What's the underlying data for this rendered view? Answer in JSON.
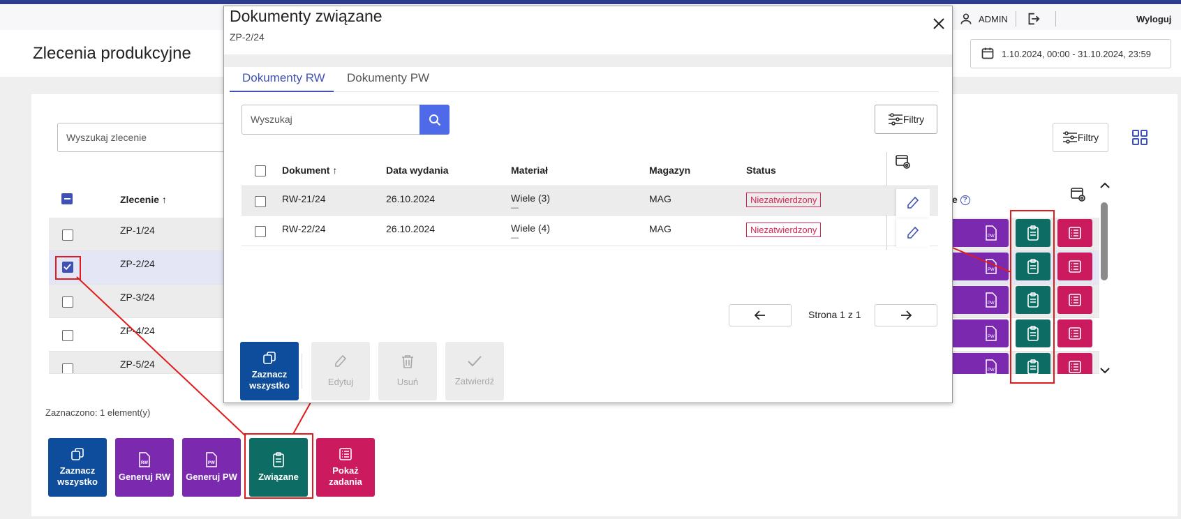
{
  "topbar": {
    "user": "ADMIN",
    "logout": "Wyloguj",
    "icons": [
      "refresh-icon",
      "help-icon",
      "user-icon",
      "logout-icon"
    ]
  },
  "page": {
    "title": "Zlecenia produkcyjne",
    "date_range": "1.10.2024, 00:00 - 31.10.2024, 23:59"
  },
  "main": {
    "search_placeholder": "Wyszukaj zlecenie",
    "filters_label": "Filtry",
    "column_header": "Zlecenie",
    "column_hint": "e",
    "rows": [
      "ZP-1/24",
      "ZP-2/24",
      "ZP-3/24",
      "ZP-4/24",
      "ZP-5/24"
    ],
    "selected_row_index": 1,
    "selected_count": "Zaznaczono: 1 element(y)",
    "action_icons": [
      "generate-pw-icon",
      "related-docs-icon",
      "tasks-icon"
    ]
  },
  "bulk_actions": [
    {
      "label": "Zaznacz wszystko",
      "color": "#0d4d9c"
    },
    {
      "label": "Generuj RW",
      "color": "#7b2ab0"
    },
    {
      "label": "Generuj PW",
      "color": "#7b2ab0"
    },
    {
      "label": "Związane",
      "color": "#0d6d64"
    },
    {
      "label": "Pokaż zadania",
      "color": "#cc1a5e"
    }
  ],
  "modal": {
    "title": "Dokumenty związane",
    "subtitle": "ZP-2/24",
    "tabs": [
      {
        "label": "Dokumenty RW",
        "active": true
      },
      {
        "label": "Dokumenty PW",
        "active": false
      }
    ],
    "search_placeholder": "Wyszukaj",
    "filters_label": "Filtry",
    "columns": [
      "Dokument",
      "Data wydania",
      "Materiał",
      "Magazyn",
      "Status"
    ],
    "rows": [
      {
        "doc": "RW-21/24",
        "date": "26.10.2024",
        "material": "Wiele (3)",
        "material_sub": "—",
        "warehouse": "MAG",
        "status": "Niezatwierdzony"
      },
      {
        "doc": "RW-22/24",
        "date": "26.10.2024",
        "material": "Wiele (4)",
        "material_sub": "—",
        "warehouse": "MAG",
        "status": "Niezatwierdzony"
      }
    ],
    "pagination": "Strona 1 z 1",
    "actions": [
      {
        "label": "Zaznacz wszystko",
        "enabled": true
      },
      {
        "label": "Edytuj",
        "enabled": false
      },
      {
        "label": "Usuń",
        "enabled": false
      },
      {
        "label": "Zatwierdź",
        "enabled": false
      }
    ]
  },
  "colors": {
    "accent": "#3f51b5",
    "highlight": "#e01b1b",
    "status_unconfirmed": "#d92553"
  }
}
